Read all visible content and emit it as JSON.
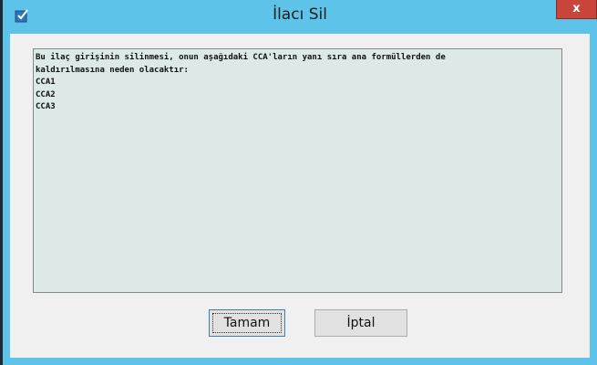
{
  "window": {
    "title": "İlacı Sil",
    "close_label": "x",
    "title_bar_color": "#5ec3e8"
  },
  "message": {
    "lines": [
      "Bu ilaç girişinin silinmesi, onun aşağıdaki CCA'ların yanı sıra ana formüllerden de",
      "kaldırılmasına neden olacaktır:",
      "CCA1",
      "CCA2",
      "CCA3"
    ]
  },
  "buttons": {
    "ok_label": "Tamam",
    "cancel_label": "İptal"
  },
  "icons": {
    "app": "app-checkbox-icon",
    "close": "close-icon"
  }
}
